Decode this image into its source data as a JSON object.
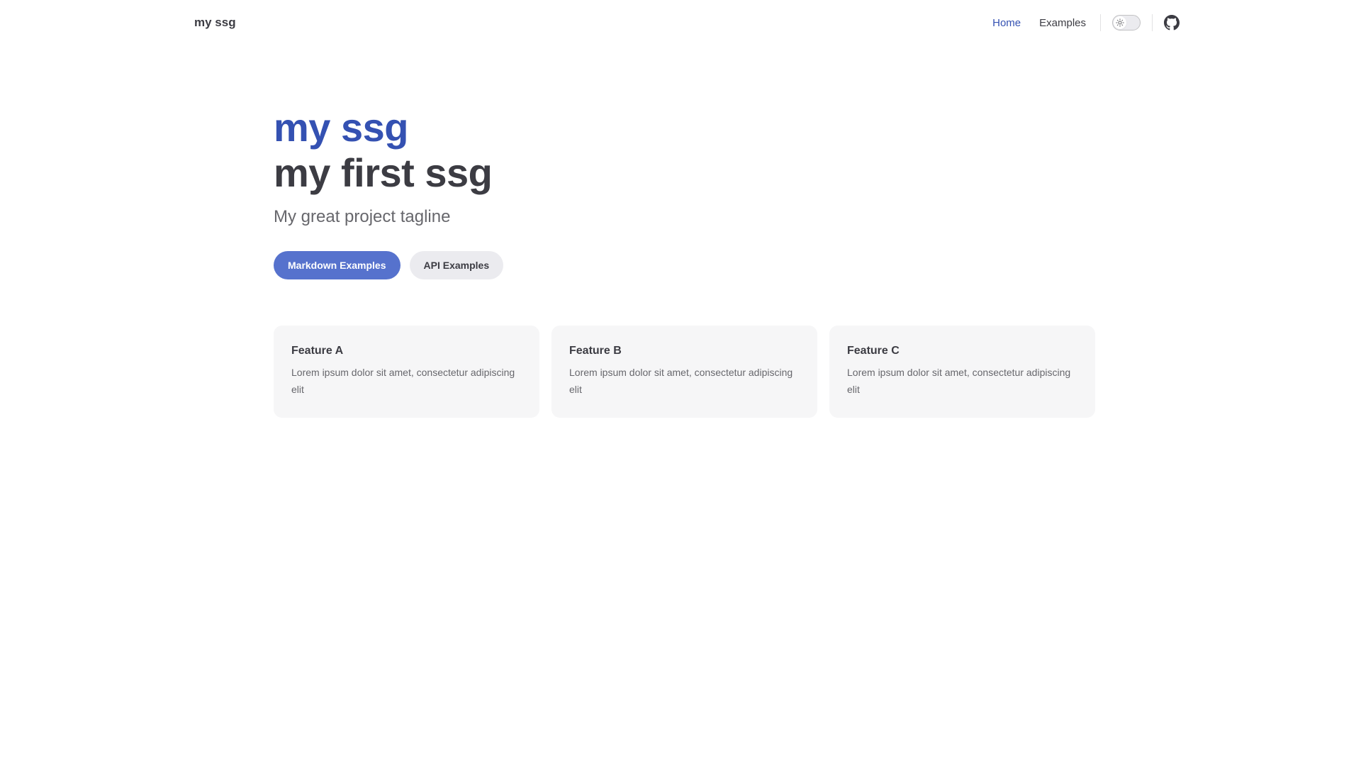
{
  "nav": {
    "brand": "my ssg",
    "links": [
      {
        "label": "Home",
        "active": true
      },
      {
        "label": "Examples",
        "active": false
      }
    ],
    "theme_toggle_icon": "sun-icon",
    "social_icon": "github-icon"
  },
  "hero": {
    "name": "my ssg",
    "text": "my first ssg",
    "tagline": "My great project tagline",
    "actions": [
      {
        "label": "Markdown Examples",
        "theme": "brand"
      },
      {
        "label": "API Examples",
        "theme": "alt"
      }
    ]
  },
  "features": [
    {
      "title": "Feature A",
      "details": "Lorem ipsum dolor sit amet, consectetur adipiscing elit"
    },
    {
      "title": "Feature B",
      "details": "Lorem ipsum dolor sit amet, consectetur adipiscing elit"
    },
    {
      "title": "Feature C",
      "details": "Lorem ipsum dolor sit amet, consectetur adipiscing elit"
    }
  ],
  "colors": {
    "brand": "#3451b2",
    "brand_button": "#5672cd",
    "text": "#3c3c43",
    "muted_text": "#67676c",
    "card_bg": "#f6f6f7"
  }
}
